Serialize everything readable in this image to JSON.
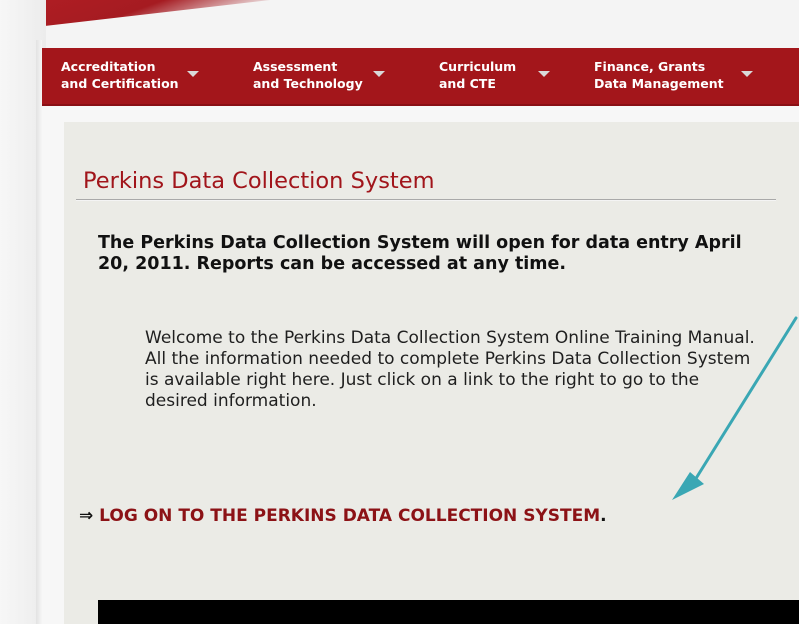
{
  "nav": {
    "items": [
      {
        "line1": "Accreditation",
        "line2": "and Certification"
      },
      {
        "line1": "Assessment",
        "line2": "and Technology"
      },
      {
        "line1": "Curriculum",
        "line2": "and CTE"
      },
      {
        "line1": "Finance, Grants",
        "line2": "Data Management"
      }
    ]
  },
  "main": {
    "title": "Perkins Data Collection System",
    "notice": "The Perkins Data Collection System will open for data entry April 20, 2011. Reports can be accessed at any time.",
    "welcome": "Welcome to the Perkins Data Collection System Online Training Manual. All the information needed to complete Perkins Data Collection System is available right here. Just click on a link to the right to go to the desired information.",
    "logon": {
      "arrow": "⇒",
      "text": "LOG ON TO THE PERKINS DATA COLLECTION SYSTEM",
      "period": "."
    }
  },
  "colors": {
    "brand_red": "#a3161b",
    "annotation_arrow": "#3aa7b4"
  }
}
